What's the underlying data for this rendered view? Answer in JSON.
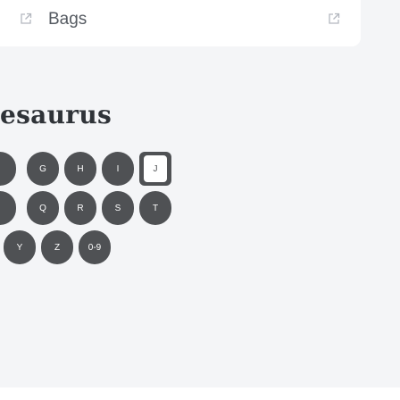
{
  "menu": {
    "item_label": "Bags",
    "item_icon": "external-link-icon",
    "trail_icon": "external-link-icon"
  },
  "logo": {
    "text": "esaurus"
  },
  "keyboard": {
    "row1": [
      "",
      "G",
      "H",
      "I",
      "J"
    ],
    "row2": [
      "",
      "Q",
      "R",
      "S",
      "T"
    ],
    "row3": [
      "Y",
      "Z",
      "0-9"
    ]
  }
}
